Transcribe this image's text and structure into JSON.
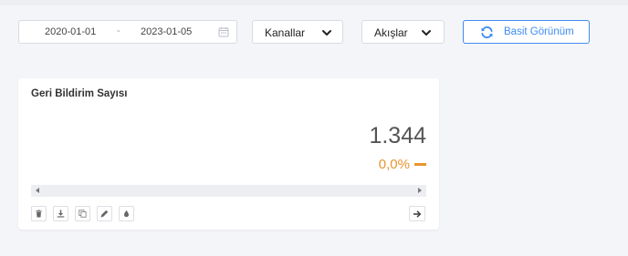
{
  "filters": {
    "date_start": "2020-01-01",
    "date_separator": "-",
    "date_end": "2023-01-05",
    "channels_label": "Kanallar",
    "flows_label": "Akışlar",
    "view_toggle_label": "Basit Görünüm"
  },
  "card": {
    "title": "Geri Bildirim Sayısı",
    "value": "1.344",
    "change": "0,0%",
    "change_trend": "neutral",
    "change_color": "#e8952e"
  },
  "icons": {
    "calendar": "calendar-icon",
    "chevron": "chevron-down-icon",
    "refresh": "refresh-icon",
    "actions": [
      "trash-icon",
      "download-icon",
      "copy-icon",
      "pencil-icon",
      "drop-icon"
    ],
    "navigate": "arrow-right-icon"
  },
  "colors": {
    "accent": "#3f8cf0",
    "background": "#f4f5f8",
    "warning": "#e8952e"
  }
}
